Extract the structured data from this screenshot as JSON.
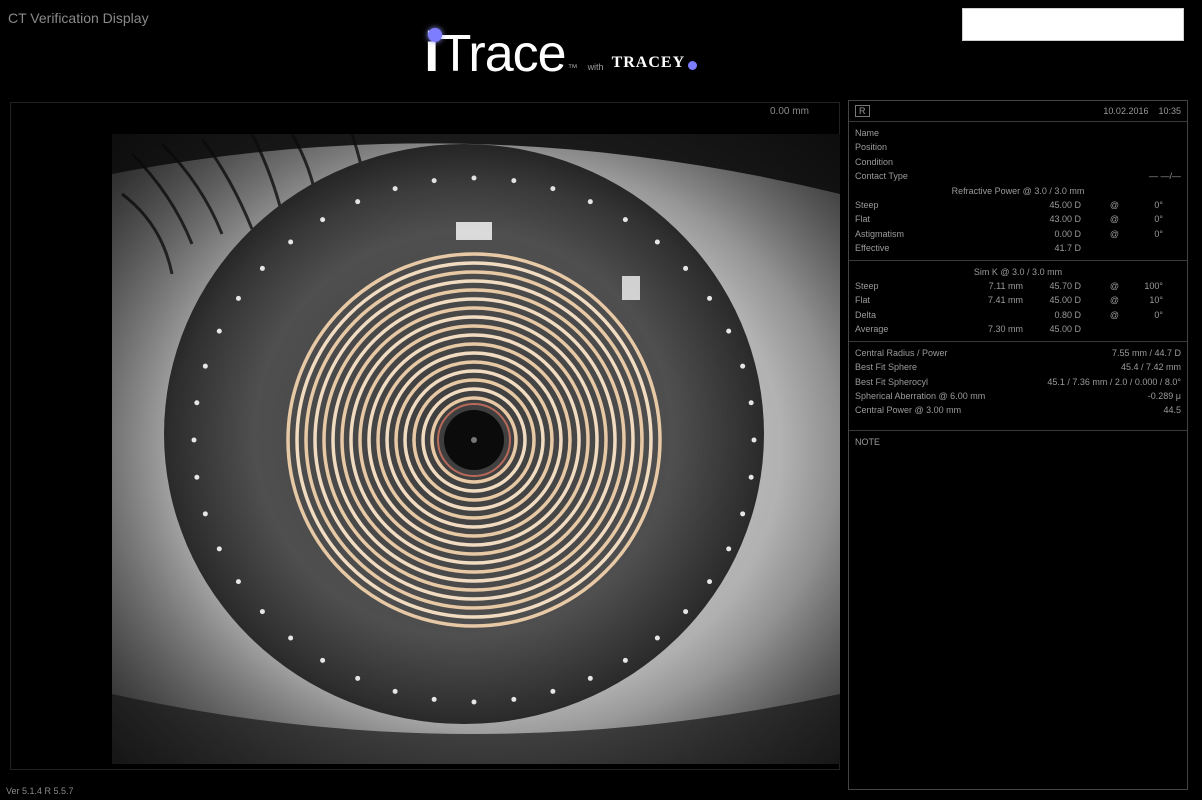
{
  "window": {
    "title": "CT Verification Display"
  },
  "logo": {
    "brand": "Trace",
    "tm": "™",
    "sub": "with",
    "partner": "TRACEY"
  },
  "search": {
    "value": "",
    "placeholder": ""
  },
  "eye_view": {
    "zoom": "0.00 mm"
  },
  "panel": {
    "eye": "R",
    "date": "10.02.2016",
    "time": "10:35",
    "rows1": [
      {
        "k": "Name"
      },
      {
        "k": "Position"
      },
      {
        "k": "Condition"
      },
      {
        "k": "Contact Type",
        "v": "— —/—"
      }
    ],
    "section1_title": "Refractive Power @ 3.0 / 3.0 mm",
    "rows2": [
      {
        "k": "Steep",
        "c2": "",
        "c3": "45.00 D",
        "c4": "@",
        "c5": "0°"
      },
      {
        "k": "Flat",
        "c2": "",
        "c3": "43.00 D",
        "c4": "@",
        "c5": "0°"
      },
      {
        "k": "Astigmatism",
        "c2": "",
        "c3": "0.00 D",
        "c4": "@",
        "c5": "0°"
      },
      {
        "k": "Effective",
        "c2": "",
        "c3": "41.7 D",
        "c4": "",
        "c5": ""
      }
    ],
    "section2_title": "Sim K @ 3.0 / 3.0 mm",
    "rows3": [
      {
        "k": "Steep",
        "c2": "7.11 mm",
        "c3": "45.70 D",
        "c4": "@",
        "c5": "100°"
      },
      {
        "k": "Flat",
        "c2": "7.41 mm",
        "c3": "45.00 D",
        "c4": "@",
        "c5": "10°"
      },
      {
        "k": "Delta",
        "c2": "",
        "c3": "0.80 D",
        "c4": "@",
        "c5": "0°"
      },
      {
        "k": "Average",
        "c2": "7.30 mm",
        "c3": "45.00 D",
        "c4": "",
        "c5": ""
      }
    ],
    "rows4": [
      {
        "k": "Central Radius / Power",
        "v": "7.55 mm / 44.7 D"
      },
      {
        "k": "Best Fit Sphere",
        "v": "45.4 / 7.42 mm"
      },
      {
        "k": "Best Fit Spherocyl",
        "v": "45.1 / 7.36 mm / 2.0 / 0.000 / 8.0°"
      },
      {
        "k": "Spherical Aberration @ 6.00 mm",
        "v": "-0.289 μ"
      },
      {
        "k": "Central Power @ 3.00 mm",
        "v": "44.5"
      }
    ],
    "section3_title": "NOTE"
  },
  "footer": {
    "version": "Ver 5.1.4 R 5.5.7"
  }
}
